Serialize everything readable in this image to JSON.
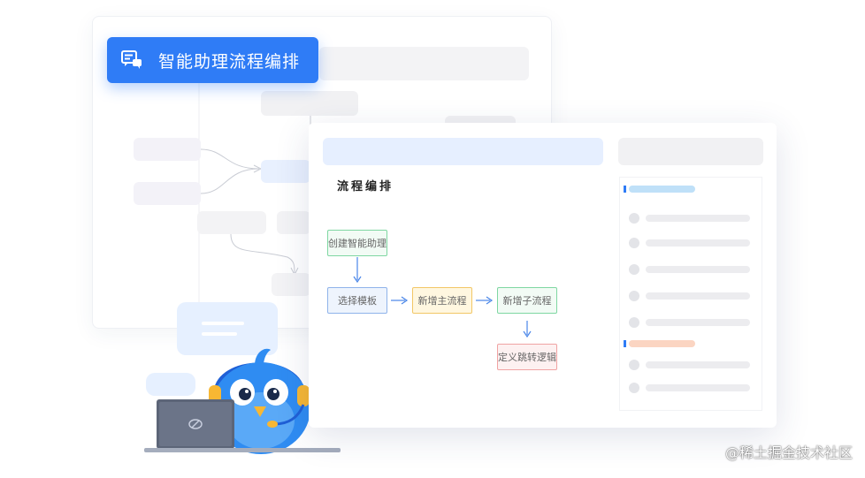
{
  "header": {
    "title": "智能助理流程编排"
  },
  "editor": {
    "section_title": "流程编排",
    "nodes": {
      "create": "创建智能助理",
      "template": "选择模板",
      "main_flow": "新增主流程",
      "sub_flow": "新增子流程",
      "jump_logic": "定义跳转逻辑"
    }
  },
  "watermark": "@稀土掘金技术社区",
  "colors": {
    "primary": "#2f7cf6",
    "node_green": "#7fd7a2",
    "node_blue": "#8fb3ea",
    "node_yellow": "#f2c766",
    "node_pink": "#f0a3a3",
    "panel_accent_blue": "#bfe0f8",
    "panel_accent_orange": "#fbd5c2"
  }
}
